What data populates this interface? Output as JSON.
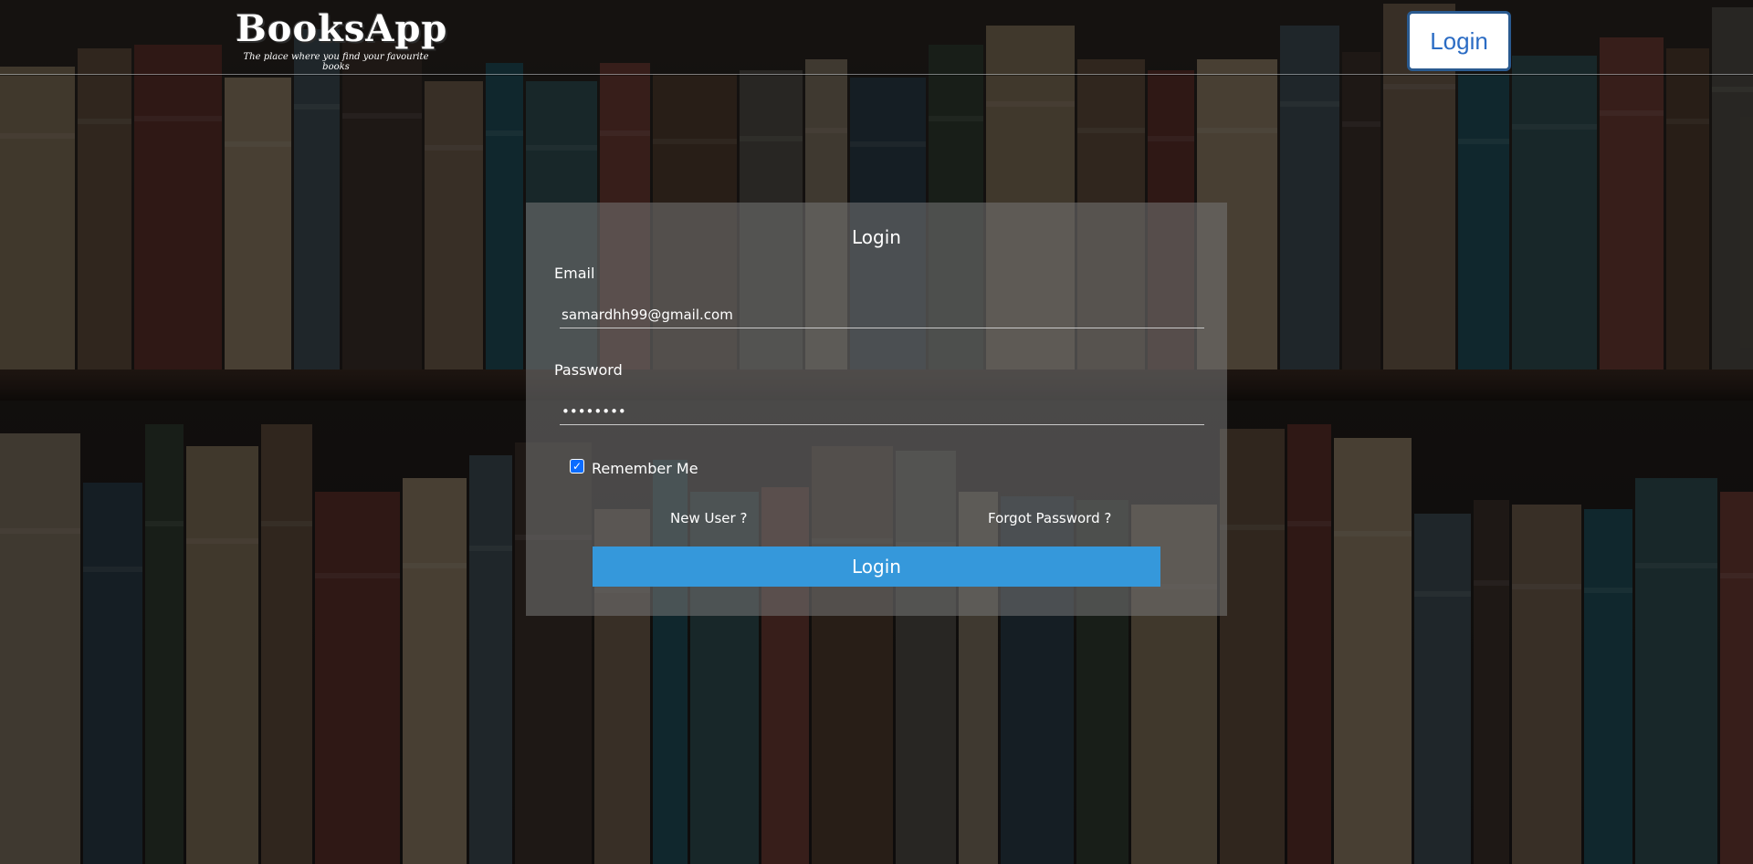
{
  "app": {
    "brand_title": "BooksApp",
    "brand_tagline": "The place where you find your favourite books",
    "nav_login_label": "Login"
  },
  "form": {
    "title": "Login",
    "email_label": "Email",
    "email_value": "samardhh99@gmail.com",
    "password_label": "Password",
    "password_value": "••••••••",
    "remember_label": "Remember Me",
    "remember_checked": true,
    "new_user_link": "New User ?",
    "forgot_password_link": "Forgot Password ?",
    "submit_label": "Login"
  },
  "colors": {
    "submit_button": "#3598db",
    "nav_login_border": "#2a5a8f",
    "nav_login_text": "#2b6cc4"
  }
}
